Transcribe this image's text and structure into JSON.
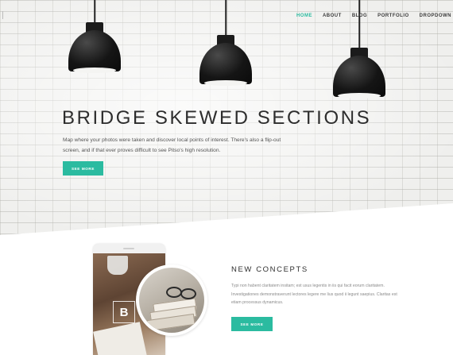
{
  "nav": {
    "items": [
      {
        "label": "HOME",
        "active": true
      },
      {
        "label": "ABOUT",
        "active": false
      },
      {
        "label": "BLOG",
        "active": false
      },
      {
        "label": "PORTFOLIO",
        "active": false
      },
      {
        "label": "DROPDOWN",
        "active": false
      }
    ]
  },
  "hero": {
    "title": "BRIDGE SKEWED SECTIONS",
    "description": "Map where your photos were taken and discover local points of interest. There's also a flip-out screen, and if that ever proves difficult to see Pitso's high resolution.",
    "button_label": "SEE MORE"
  },
  "feature": {
    "phone_logo": "B",
    "title": "NEW CONCEPTS",
    "description": "Typi non habent claritatem insitam; est usus legentis in iis qui facit eorum claritatem. Investigationes demonstraverunt lectores legere me lius quod ii legunt saepius. Claritas est etiam processus dynamicus.",
    "button_label": "SEE MORE"
  },
  "colors": {
    "accent": "#2bbba0",
    "heading": "#2d2d2d",
    "body_text": "#555555"
  },
  "icons": [
    "pendant-lamp-icon"
  ]
}
